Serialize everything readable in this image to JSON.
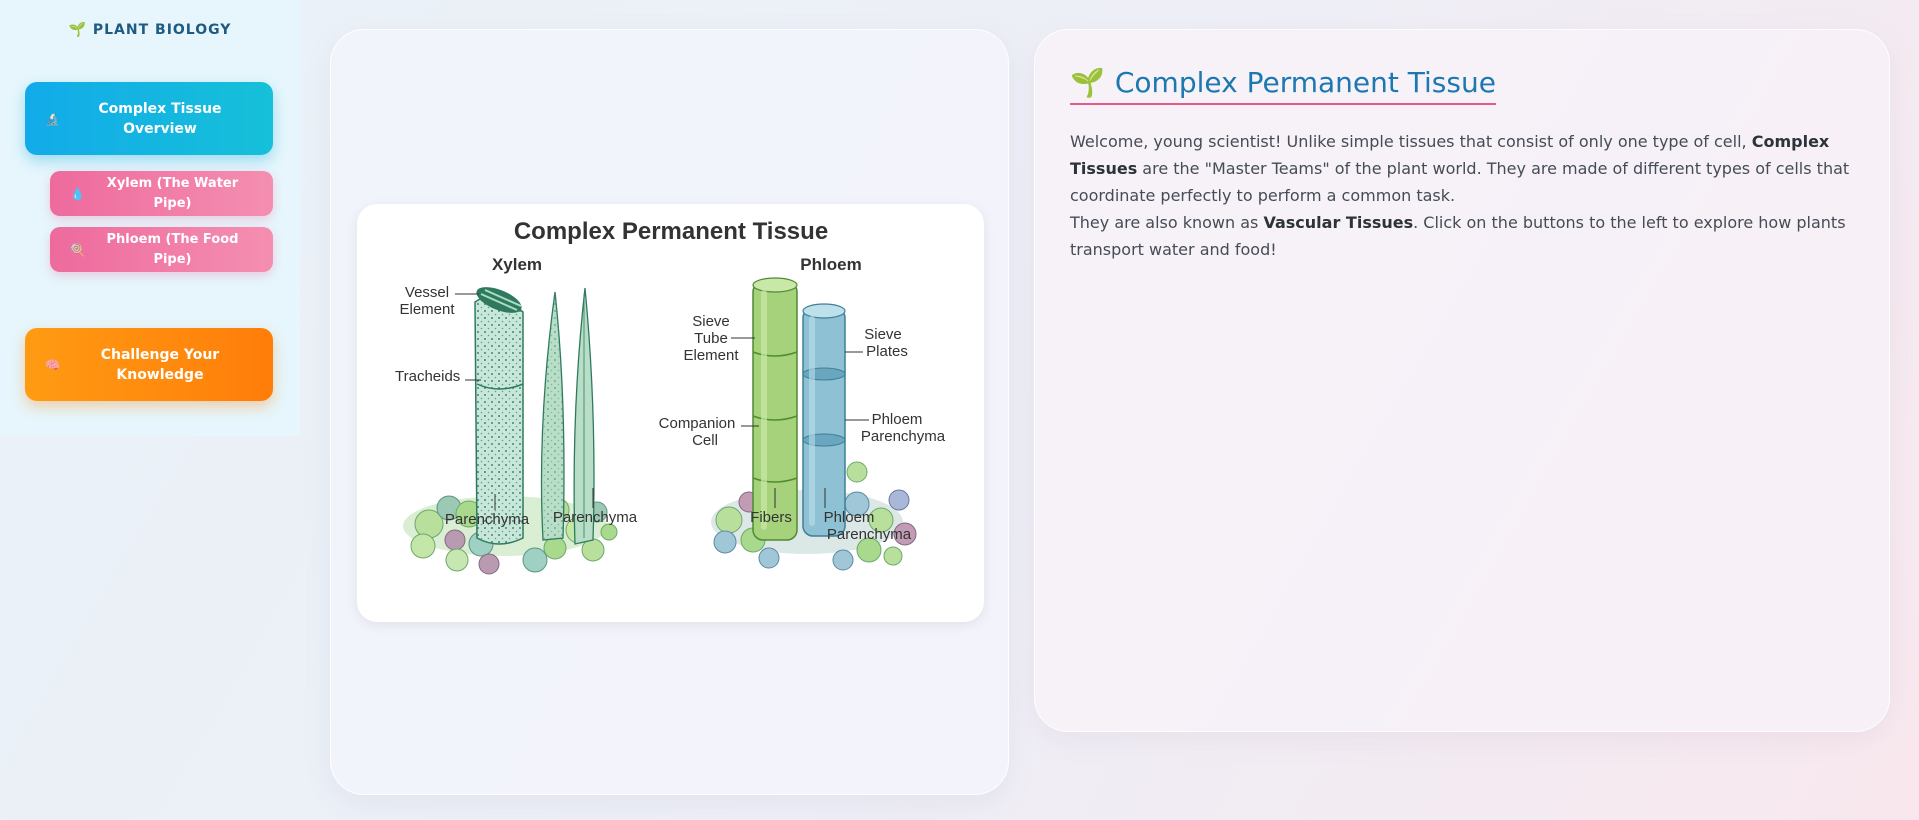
{
  "sidebar": {
    "brand_icon": "🌱",
    "brand": "PLANT BIOLOGY",
    "buttons": {
      "overview": {
        "icon": "🔬",
        "label": "Complex Tissue Overview"
      },
      "xylem": {
        "icon": "💧",
        "label": "Xylem (The Water Pipe)"
      },
      "phloem": {
        "icon": "🍭",
        "label": "Phloem (The Food Pipe)"
      },
      "challenge": {
        "icon": "🧠",
        "label": "Challenge Your Knowledge"
      }
    }
  },
  "figure": {
    "title": "Complex Permanent Tissue",
    "xylem": {
      "heading": "Xylem",
      "vessel_element_1": "Vessel",
      "vessel_element_2": "Element",
      "tracheids": "Tracheids",
      "parenchyma_left": "Parenchyma",
      "parenchyma_right": "Parenchyma"
    },
    "phloem": {
      "heading": "Phloem",
      "sieve_tube_1": "Sieve",
      "sieve_tube_2": "Tube",
      "sieve_tube_3": "Element",
      "sieve_plates_1": "Sieve",
      "sieve_plates_2": "Plates",
      "companion_1": "Companion",
      "companion_2": "Cell",
      "phloem_par_1": "Phloem",
      "phloem_par_2": "Parenchyma",
      "fibers": "Fibers",
      "phloem_par_bottom_1": "Phloem",
      "phloem_par_bottom_2": "Parenchyma"
    }
  },
  "info": {
    "title_icon": "🌱",
    "title": "Complex Permanent Tissue",
    "p1_a": "Welcome, young scientist! Unlike simple tissues that consist of only one type of cell, ",
    "p1_bold": "Complex Tissues",
    "p1_b": " are the \"Master Teams\" of the plant world. They are made of different types of cells that coordinate perfectly to perform a common task.",
    "p2_a": "They are also known as ",
    "p2_bold": "Vascular Tissues",
    "p2_b": ". Click on the buttons to the left to explore how plants transport water and food!"
  }
}
